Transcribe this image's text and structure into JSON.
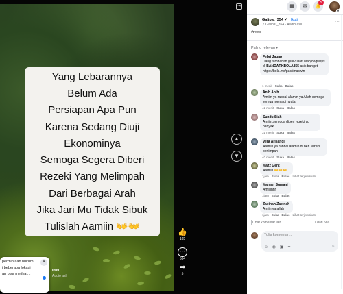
{
  "video": {
    "overlay_lines": [
      "Yang Lebarannya",
      "Belum Ada",
      "Persiapan Apa Pun",
      "Karena Sedang Diuji",
      "Ekonominya",
      "Semoga Segera Diberi",
      "Rezeki Yang Melimpah",
      "Dari Berbagai Arah",
      "Jika Jari Mu Tidak Sibuk",
      "Tulislah Aamiin"
    ],
    "overlay_emoji": "👐👐",
    "author_name": "Ikuti",
    "author_sub": "Audio asli",
    "likes": "185",
    "comments": "564",
    "shares": "5"
  },
  "notification": {
    "lines": [
      "permintaan hukum.",
      "i beberapa lokasi",
      "an bisa melihat..."
    ],
    "close": "✕"
  },
  "topbar": {
    "badge": "5"
  },
  "post": {
    "author": "Galipat_354",
    "verified": "✔",
    "follow": "· Ikuti",
    "sub": "♫ Galipat_354 · Audio asli",
    "more": "···",
    "tag": "#reels"
  },
  "sort_label": "Paling relevan ▾",
  "comments": [
    {
      "name": "Febri Jagap",
      "text_parts": [
        "Uang tambahan gue? Dari Mahjongways di ",
        "BANDARKBOLA855",
        " asik banget https://bola.ms/pastimaswin"
      ],
      "time": "1 menit",
      "like": "Suka",
      "reply": "Balas"
    },
    {
      "name": "Anih Anih",
      "text": "Amiiin ya rabbal alamin ya Allah semoga semua menjadi nyata",
      "time": "42 menit",
      "like": "Suka",
      "reply": "Balas"
    },
    {
      "name": "Sundu Siah",
      "text": "Amiiin.semoga diberi rezeki yg banyak",
      "time": "31 menit",
      "like": "Suka",
      "reply": "Balas"
    },
    {
      "name": "Vera Arisandi",
      "text": "Aamiin ya rabbal alamin di beri rezeki berlimpah",
      "time": "40 menit",
      "like": "Suka",
      "reply": "Balas"
    },
    {
      "name": "Mazz Gent",
      "text": "Aamiin",
      "reaction": "👐👐👐",
      "time": "1jam",
      "like": "Suka",
      "reply": "Balas",
      "extra": "Lihat terjemahan"
    },
    {
      "name": "Maman Sumani",
      "text": "Amiiiinnn",
      "time": "1jam",
      "like": "Suka",
      "reply": "Balas"
    },
    {
      "name": "Zaeinah Zaeinah",
      "text": "Amiin ya allah",
      "time": "1jam",
      "like": "Suka",
      "reply": "Balas",
      "extra": "Lihat terjemahan"
    }
  ],
  "more_comments": "Lihat komentar lain",
  "more_count": "7 dari 566",
  "composer": {
    "placeholder": "Tulis komentar...",
    "tools": "☺ ◉ ▣ ✦",
    "send": "➤"
  }
}
